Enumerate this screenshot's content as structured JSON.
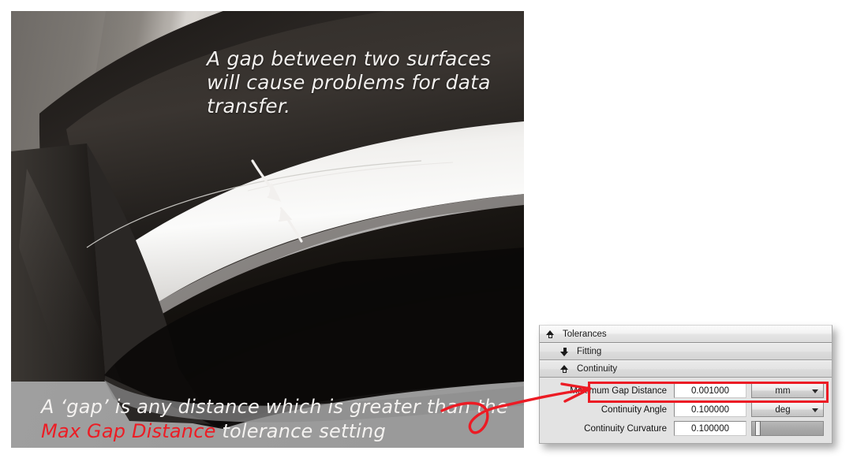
{
  "figure": {
    "name": "surface-gap-render",
    "caption_top": "A gap between two surfaces\nwill cause problems for data\ntransfer.",
    "caption_bottom_pre": "A ‘gap’ is any distance which is greater than\nthe ",
    "caption_bottom_accent": "Max Gap Distance",
    "caption_bottom_post": " tolerance setting",
    "annotation_arrows": [
      "gap-arrow-upper",
      "gap-arrow-lower"
    ],
    "colors": {
      "caption_text": "#f4f2f0",
      "accent": "#ed1c24",
      "floor": "#9d9d9d"
    }
  },
  "panel": {
    "name": "tolerances-panel",
    "sections": [
      {
        "label": "Tolerances",
        "icon": "chevron-up-hollow-icon",
        "level": 1,
        "expanded": true
      },
      {
        "label": "Fitting",
        "icon": "arrow-down-solid-icon",
        "level": 2,
        "expanded": false
      },
      {
        "label": "Continuity",
        "icon": "chevron-up-hollow-icon",
        "level": 2,
        "expanded": true
      }
    ],
    "fields": [
      {
        "label": "Maximum Gap Distance",
        "value": "0.001000",
        "control": "unit-select",
        "unit": "mm",
        "highlighted": true
      },
      {
        "label": "Continuity Angle",
        "value": "0.100000",
        "control": "unit-select",
        "unit": "deg",
        "highlighted": false
      },
      {
        "label": "Continuity Curvature",
        "value": "0.100000",
        "control": "slider",
        "unit": "",
        "highlighted": false
      }
    ],
    "highlight_color": "#ec1b24"
  }
}
